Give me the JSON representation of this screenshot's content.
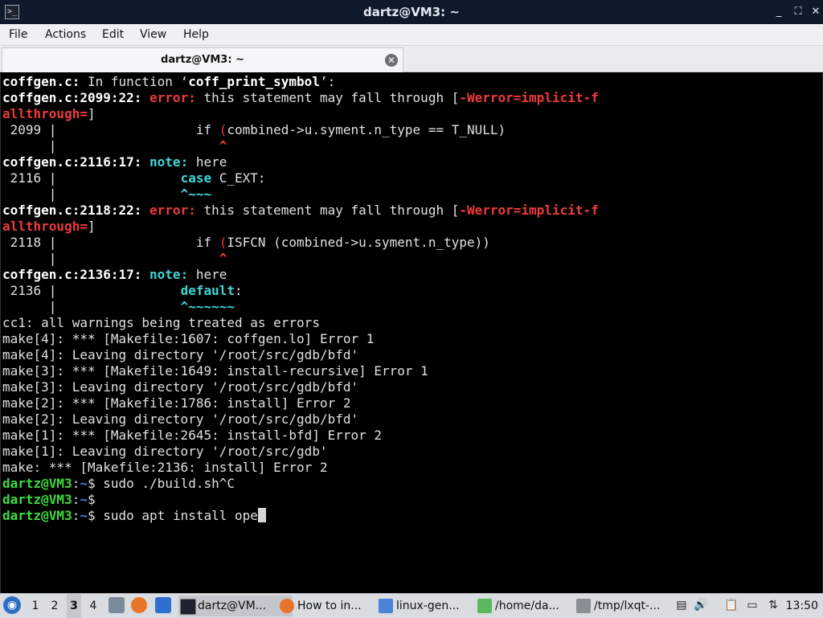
{
  "window": {
    "title": "dartz@VM3: ~",
    "app_icon": "terminal-icon",
    "controls": {
      "minimize": "_",
      "maximize": "⛶",
      "close": "✕"
    }
  },
  "menubar": [
    "File",
    "Actions",
    "Edit",
    "View",
    "Help"
  ],
  "tab": {
    "label": "dartz@VM3: ~",
    "close": "✕"
  },
  "terminal": {
    "prompt_user": "dartz@VM3",
    "prompt_path": "~",
    "lines": {
      "l1": {
        "a": "coffgen.c:",
        "b": " In function ‘",
        "c": "coff_print_symbol",
        "d": "’:"
      },
      "l2": {
        "a": "coffgen.c:2099:22: ",
        "b": "error:",
        "c": " this statement may fall through [",
        "d": "-Werror=implicit-f"
      },
      "l3": {
        "a": "allthrough=",
        "b": "]"
      },
      "l4": {
        "a": " 2099 |                  if ",
        "b": "(",
        "c": "combined->u.syment.n_type == T_NULL)"
      },
      "l5": {
        "a": "      |                     ",
        "b": "^"
      },
      "l6": {
        "a": "coffgen.c:2116:17: ",
        "b": "note:",
        "c": " here"
      },
      "l7": {
        "a": " 2116 |                ",
        "b": "case",
        "c": " C_EXT:"
      },
      "l8": {
        "a": "      |                ",
        "b": "^~~~"
      },
      "l9": {
        "a": "coffgen.c:2118:22: ",
        "b": "error:",
        "c": " this statement may fall through [",
        "d": "-Werror=implicit-f"
      },
      "l10": {
        "a": "allthrough=",
        "b": "]"
      },
      "l11": {
        "a": " 2118 |                  if ",
        "b": "(",
        "c": "ISFCN (combined->u.syment.n_type))"
      },
      "l12": {
        "a": "      |                     ",
        "b": "^"
      },
      "l13": {
        "a": "coffgen.c:2136:17: ",
        "b": "note:",
        "c": " here"
      },
      "l14": {
        "a": " 2136 |                ",
        "b": "default",
        "c": ":"
      },
      "l15": {
        "a": "      |                ",
        "b": "^~~~~~~"
      },
      "l16": "cc1: all warnings being treated as errors",
      "l17": "make[4]: *** [Makefile:1607: coffgen.lo] Error 1",
      "l18": "make[4]: Leaving directory '/root/src/gdb/bfd'",
      "l19": "make[3]: *** [Makefile:1649: install-recursive] Error 1",
      "l20": "make[3]: Leaving directory '/root/src/gdb/bfd'",
      "l21": "make[2]: *** [Makefile:1786: install] Error 2",
      "l22": "make[2]: Leaving directory '/root/src/gdb/bfd'",
      "l23": "make[1]: *** [Makefile:2645: install-bfd] Error 2",
      "l24": "make[1]: Leaving directory '/root/src/gdb'",
      "l25": "make: *** [Makefile:2136: install] Error 2",
      "l26": {
        "cmd": "$ sudo ./build.sh^C"
      },
      "l27": {
        "cmd": "$"
      },
      "l28": {
        "cmd": "$ sudo apt install ope"
      }
    }
  },
  "taskbar": {
    "workspaces": [
      "1",
      "2",
      "3",
      "4"
    ],
    "active_workspace": "3",
    "tasks": [
      {
        "label": "dartz@VM...",
        "icon": "terminal-icon"
      },
      {
        "label": "How to in...",
        "icon": "firefox-icon"
      },
      {
        "label": "linux-gen...",
        "icon": "folder-icon"
      },
      {
        "label": "/home/da...",
        "icon": "text-editor-icon"
      },
      {
        "label": "/tmp/lxqt-...",
        "icon": "editor-icon"
      }
    ],
    "clock": "13:50"
  }
}
